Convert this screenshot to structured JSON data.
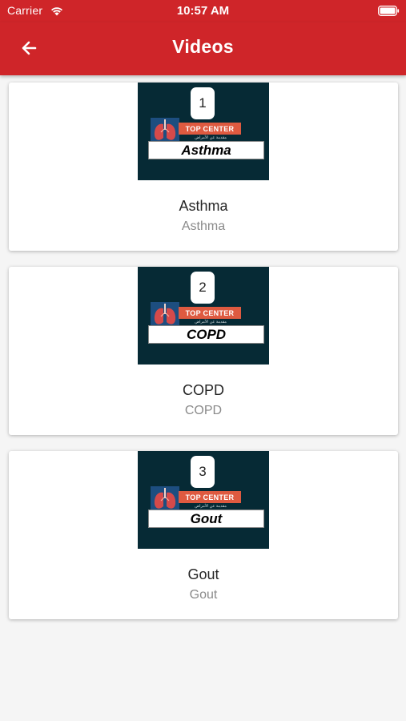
{
  "status_bar": {
    "carrier": "Carrier",
    "time": "10:57 AM",
    "wifi_icon": "wifi-icon",
    "battery_icon": "battery-icon"
  },
  "app_bar": {
    "title": "Videos",
    "back_icon": "arrow-left-icon",
    "background_color": "#cf2529"
  },
  "videos": [
    {
      "number": "1",
      "brand": "TOP CENTER",
      "brand_subtitle": "مقدمة عن الأمراض",
      "thumbnail_label": "Asthma",
      "title": "Asthma",
      "subtitle": "Asthma"
    },
    {
      "number": "2",
      "brand": "TOP CENTER",
      "brand_subtitle": "مقدمة عن الأمراض",
      "thumbnail_label": "COPD",
      "title": "COPD",
      "subtitle": "COPD"
    },
    {
      "number": "3",
      "brand": "TOP CENTER",
      "brand_subtitle": "مقدمة عن الأمراض",
      "thumbnail_label": "Gout",
      "title": "Gout",
      "subtitle": "Gout"
    }
  ]
}
